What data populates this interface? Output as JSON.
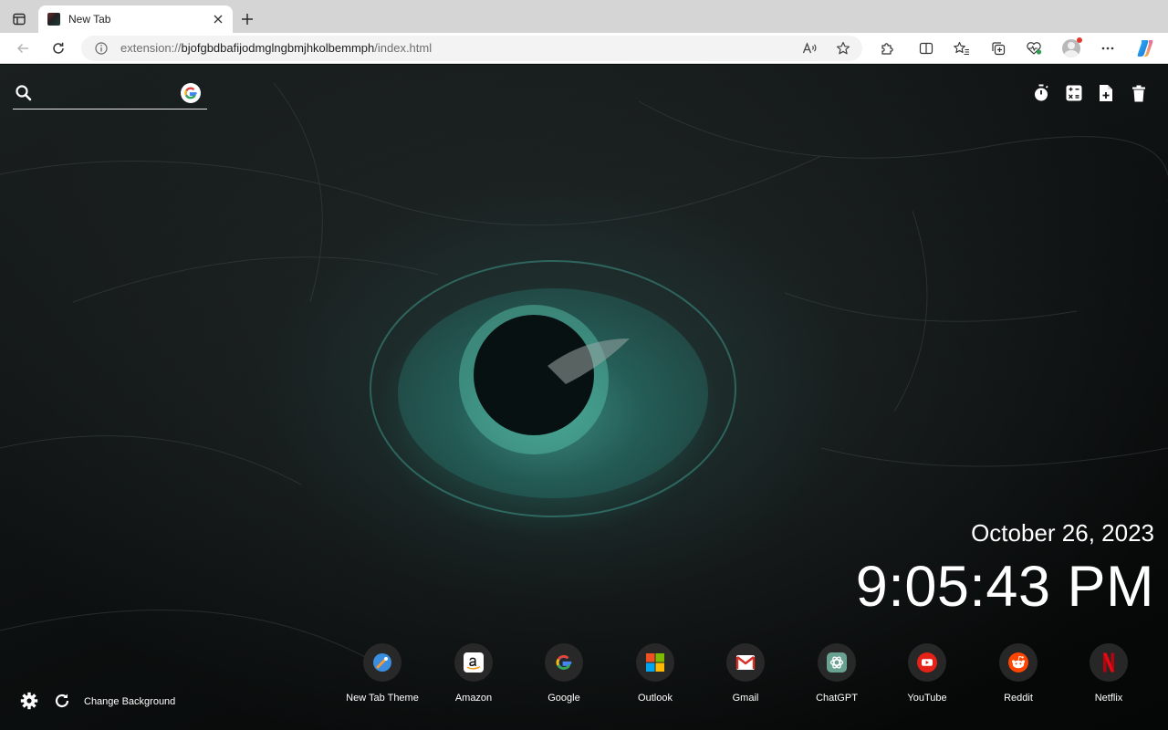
{
  "browser": {
    "tab": {
      "title": "New Tab"
    },
    "address_bar": {
      "url_scheme": "extension://",
      "url_host": "bjofgbdbafijodmglngbmjhkolbemmph",
      "url_path": "/index.html"
    }
  },
  "page": {
    "search": {
      "placeholder": "",
      "engine_icon": "google-icon"
    },
    "tools": [
      "timer-icon",
      "calculator-icon",
      "add-note-icon",
      "trash-icon"
    ],
    "clock": {
      "date": "October 26, 2023",
      "time": "9:05:43 PM"
    },
    "shortcuts": [
      {
        "label": "New Tab Theme",
        "icon": "new-tab-theme-icon"
      },
      {
        "label": "Amazon",
        "icon": "amazon-icon"
      },
      {
        "label": "Google",
        "icon": "google-icon"
      },
      {
        "label": "Outlook",
        "icon": "outlook-icon"
      },
      {
        "label": "Gmail",
        "icon": "gmail-icon"
      },
      {
        "label": "ChatGPT",
        "icon": "chatgpt-icon"
      },
      {
        "label": "YouTube",
        "icon": "youtube-icon"
      },
      {
        "label": "Reddit",
        "icon": "reddit-icon"
      },
      {
        "label": "Netflix",
        "icon": "netflix-icon"
      }
    ],
    "footer": {
      "change_background_label": "Change Background"
    }
  }
}
